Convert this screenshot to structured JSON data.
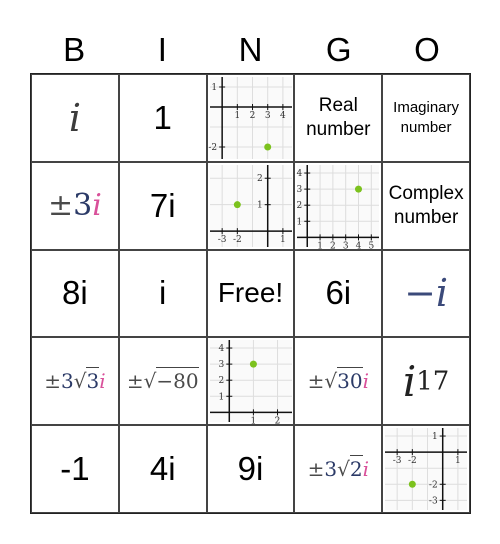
{
  "header": {
    "letters": [
      "B",
      "I",
      "N",
      "G",
      "O"
    ]
  },
  "cells": {
    "r0c0": {
      "type": "math",
      "text": "i"
    },
    "r0c1": {
      "type": "text",
      "text": "1"
    },
    "r0c2": {
      "type": "graph",
      "point": [
        3,
        -2
      ],
      "x_ticks": [
        "1",
        "2",
        "3",
        "4"
      ],
      "y_ticks": [
        "1",
        "-2"
      ]
    },
    "r0c3": {
      "type": "text",
      "line1": "Real",
      "line2": "number"
    },
    "r0c4": {
      "type": "text",
      "line1": "Imaginary",
      "line2": "number"
    },
    "r1c0": {
      "type": "math",
      "pm": "±",
      "num": "3",
      "i": "i"
    },
    "r1c1": {
      "type": "text",
      "text": "7i"
    },
    "r1c2": {
      "type": "graph",
      "point": [
        -2,
        1
      ],
      "x_ticks": [
        "-3",
        "-2",
        "1"
      ],
      "y_ticks": [
        "2",
        "1"
      ]
    },
    "r1c3": {
      "type": "graph",
      "point": [
        4,
        3
      ],
      "x_ticks": [
        "1",
        "2",
        "3",
        "4",
        "5"
      ],
      "y_ticks": [
        "4",
        "3",
        "2",
        "1"
      ]
    },
    "r1c4": {
      "type": "text",
      "line1": "Complex",
      "line2": "number"
    },
    "r2c0": {
      "type": "text",
      "text": "8i"
    },
    "r2c1": {
      "type": "text",
      "text": "i"
    },
    "r2c2": {
      "type": "free",
      "text": "Free!"
    },
    "r2c3": {
      "type": "text",
      "text": "6i"
    },
    "r2c4": {
      "type": "math",
      "text": "−i"
    },
    "r3c0": {
      "type": "math",
      "pm": "±",
      "coef": "3",
      "radicand": "3",
      "i": "i"
    },
    "r3c1": {
      "type": "math",
      "pm": "±",
      "radicand": "−80"
    },
    "r3c2": {
      "type": "graph",
      "point": [
        1,
        3
      ],
      "x_ticks": [
        "1",
        "2"
      ],
      "y_ticks": [
        "4",
        "3",
        "2",
        "1"
      ]
    },
    "r3c3": {
      "type": "math",
      "pm": "±",
      "radicand": "30",
      "i": "i"
    },
    "r3c4": {
      "type": "math",
      "base": "i",
      "exp": "17"
    },
    "r4c0": {
      "type": "text",
      "text": "-1"
    },
    "r4c1": {
      "type": "text",
      "text": "4i"
    },
    "r4c2": {
      "type": "text",
      "text": "9i"
    },
    "r4c3": {
      "type": "math",
      "pm": "±",
      "coef": "3",
      "radicand": "2",
      "i": "i"
    },
    "r4c4": {
      "type": "graph",
      "point": [
        -2,
        -2
      ],
      "x_ticks": [
        "-3",
        "-2",
        "1"
      ],
      "y_ticks": [
        "1",
        "-2",
        "-3"
      ]
    }
  },
  "colors": {
    "point": "#7cc21e",
    "grid": "#dddddd",
    "i_pink": "#d9509a"
  }
}
